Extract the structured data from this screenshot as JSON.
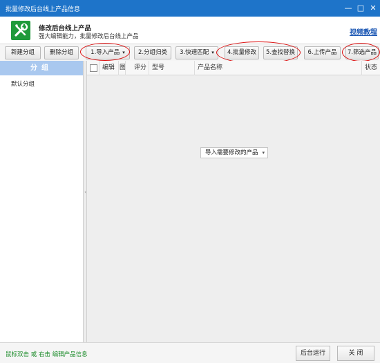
{
  "window": {
    "title": "批量修改后台线上产品信息",
    "controls": [
      "minimize-icon",
      "maximize-icon",
      "close-icon"
    ]
  },
  "header": {
    "title": "修改后台线上产品",
    "subtitle": "强大编辑能力，批量修改后台线上产品",
    "video_link": "视频教程",
    "logo_icon": "wrench-screwdriver-icon",
    "logo_color": "#1e9a3a"
  },
  "toolbar": {
    "buttons": [
      {
        "label": "新建分组"
      },
      {
        "label": "删除分组"
      },
      {
        "label": "1.导入产品",
        "dropdown": true
      },
      {
        "label": "2.分组归类"
      },
      {
        "label": "3.快速匹配",
        "dropdown": true
      },
      {
        "label": "4.批量修改"
      },
      {
        "label": "5.查找替换"
      },
      {
        "label": "6.上传产品"
      },
      {
        "label": "7.筛选产品"
      }
    ]
  },
  "sidebar": {
    "header": "分组",
    "items": [
      "默认分组"
    ]
  },
  "table": {
    "columns": [
      "编辑",
      "图",
      "评分",
      "型号",
      "产品名称",
      "状态"
    ]
  },
  "import_dropdown": {
    "label": "导入需要修改的产品"
  },
  "statusbar": {
    "hint": "鼠标双击 或 右击 编辑产品信息",
    "run_background": "后台运行",
    "close": "关 闭"
  },
  "colors": {
    "titlebar": "#1e74c9",
    "sidebar_header": "#a9c8ef",
    "annotation": "#d11111",
    "hint_text": "#1c8c2a"
  }
}
